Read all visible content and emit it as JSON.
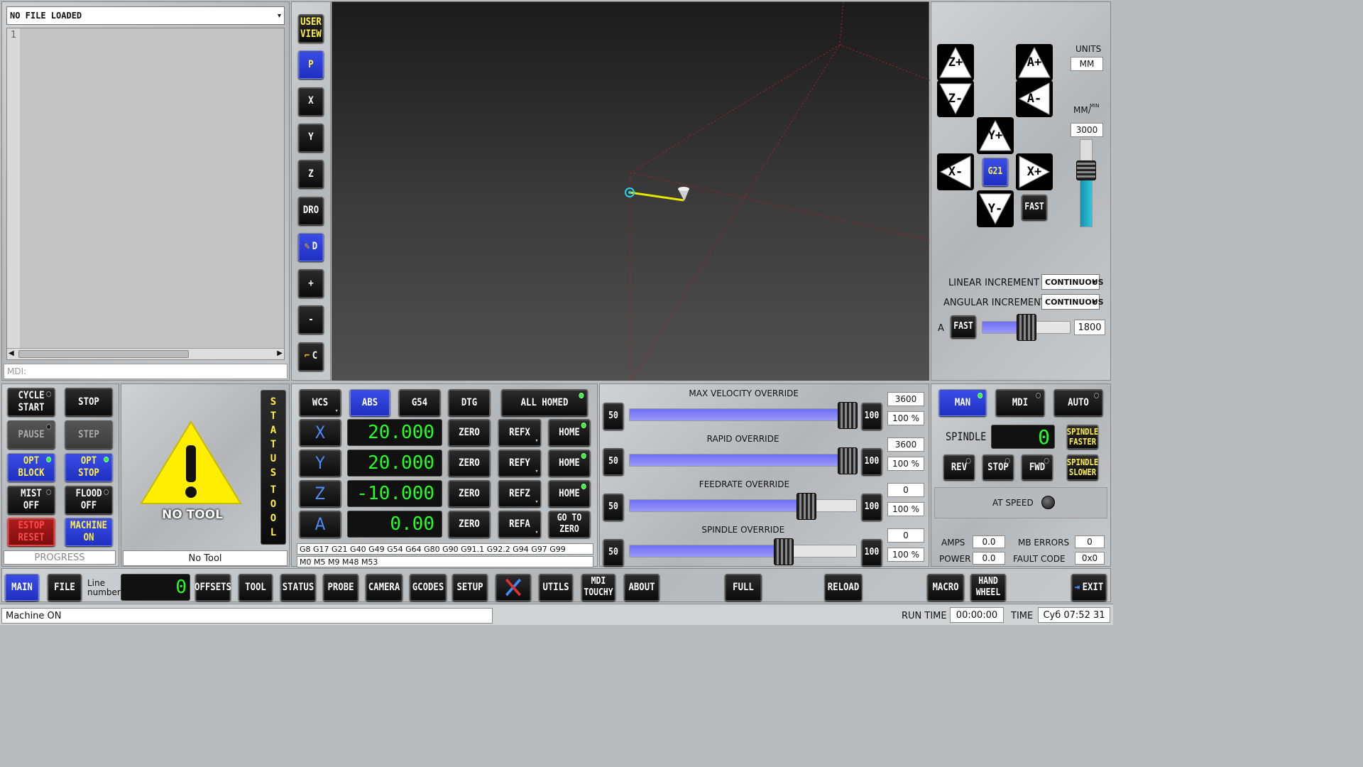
{
  "file_panel": {
    "file_name": "NO FILE LOADED",
    "line_number": "1",
    "mdi_placeholder": "MDI:"
  },
  "view_buttons": [
    {
      "label": "USER\nVIEW",
      "style": "yellow"
    },
    {
      "label": "P",
      "style": "blue"
    },
    {
      "label": "X"
    },
    {
      "label": "Y"
    },
    {
      "label": "Z"
    },
    {
      "label": "DRO"
    },
    {
      "label": "D",
      "style": "blue-w",
      "icon": "pen-icon"
    },
    {
      "label": "+"
    },
    {
      "label": "-"
    },
    {
      "label": "C",
      "icon": "broom-icon"
    }
  ],
  "jog": {
    "z_plus": "Z+",
    "z_minus": "Z-",
    "a_plus": "A+",
    "a_minus": "A-",
    "y_plus": "Y+",
    "y_minus": "Y-",
    "x_plus": "X+",
    "x_minus": "X-",
    "center": "G21",
    "fast": "FAST",
    "units_label": "UNITS",
    "units_value": "MM",
    "rate_label": "MM/",
    "rate_sup": "MIN",
    "rate_value": "3000",
    "rate_level_pct": 62,
    "linear_increment_label": "LINEAR INCREMENT",
    "linear_increment_value": "CONTINUOUS",
    "angular_increment_label": "ANGULAR INCREMENT",
    "angular_increment_value": "CONTINUOUS",
    "a_label": "A",
    "a_fast": "FAST",
    "a_rate": "1800",
    "a_level_pct": 50
  },
  "control_buttons": {
    "cycle_start": "CYCLE\nSTART",
    "stop": "STOP",
    "pause": "PAUSE",
    "step": "STEP",
    "opt_block": "OPT\nBLOCK",
    "opt_stop": "OPT\nSTOP",
    "mist": "MIST\nOFF",
    "flood": "FLOOD\nOFF",
    "estop": "ESTOP\nRESET",
    "machine": "MACHINE\nON",
    "progress": "PROGRESS"
  },
  "tool_panel": {
    "no_tool_text": "NO TOOL",
    "tool_name": "No Tool",
    "status_tool_letters": [
      "S",
      "T",
      "A",
      "T",
      "U",
      "S",
      "",
      "T",
      "O",
      "O",
      "L"
    ]
  },
  "dro_panel": {
    "header": {
      "wcs": "WCS",
      "abs": "ABS",
      "g54": "G54",
      "dtg": "DTG",
      "all_homed": "ALL HOMED"
    },
    "axes": [
      {
        "axis": "X",
        "value": "20.000",
        "zero": "ZERO",
        "ref": "REFX",
        "home": "HOME"
      },
      {
        "axis": "Y",
        "value": "20.000",
        "zero": "ZERO",
        "ref": "REFY",
        "home": "HOME"
      },
      {
        "axis": "Z",
        "value": "-10.000",
        "zero": "ZERO",
        "ref": "REFZ",
        "home": "HOME"
      },
      {
        "axis": "A",
        "value": "0.00",
        "zero": "ZERO",
        "ref": "REFA",
        "home": "GO TO\nZERO"
      }
    ],
    "gcodes": "G8 G17 G21 G40 G49 G54 G64 G80 G90 G91.1 G92.2 G94 G97 G99",
    "mcodes": "M0 M5 M9 M48 M53"
  },
  "overrides": [
    {
      "title": "MAX VELOCITY OVERRIDE",
      "min": "50",
      "max": "100",
      "value": "3600",
      "percent": "100 %",
      "level_pct": 100
    },
    {
      "title": "RAPID OVERRIDE",
      "min": "50",
      "max": "100",
      "value": "3600",
      "percent": "100 %",
      "level_pct": 100
    },
    {
      "title": "FEEDRATE OVERRIDE",
      "min": "50",
      "max": "100",
      "value": "0",
      "percent": "100 %",
      "level_pct": 82
    },
    {
      "title": "SPINDLE OVERRIDE",
      "min": "50",
      "max": "100",
      "value": "0",
      "percent": "100 %",
      "level_pct": 72
    }
  ],
  "spindle": {
    "man": "MAN",
    "mdi": "MDI",
    "auto": "AUTO",
    "label": "SPINDLE",
    "rpm": "0",
    "faster": "SPINDLE\nFASTER",
    "slower": "SPINDLE\nSLOWER",
    "rev": "REV",
    "stop": "STOP",
    "fwd": "FWD",
    "at_speed": "AT SPEED",
    "amps_label": "AMPS",
    "amps": "0.0",
    "mb_errors_label": "MB ERRORS",
    "mb_errors": "0",
    "power_label": "POWER",
    "power": "0.0",
    "fault_label": "FAULT CODE",
    "fault": "0x0"
  },
  "bottom_tabs": {
    "main": "MAIN",
    "file": "FILE",
    "line_number_label": "Line\nnumber",
    "line_number": "0",
    "offsets": "OFFSETS",
    "tool": "TOOL",
    "status": "STATUS",
    "probe": "PROBE",
    "camera": "CAMERA",
    "gcodes": "GCODES",
    "setup": "SETUP",
    "utils": "UTILS",
    "mdi_touchy": "MDI\nTOUCHY",
    "about": "ABOUT",
    "full": "FULL",
    "reload": "RELOAD",
    "macro": "MACRO",
    "hand_wheel": "HAND\nWHEEL",
    "exit": "EXIT"
  },
  "status_bar": {
    "message": "Machine ON",
    "run_time_label": "RUN TIME",
    "run_time": "00:00:00",
    "time_label": "TIME",
    "time": "Суб 07:52 31"
  },
  "colors": {
    "accent_blue": "#2a3fe0",
    "dro_green": "#22ff22",
    "toolpath_yellow": "#e6e600",
    "warning_yellow": "#ffee00"
  }
}
